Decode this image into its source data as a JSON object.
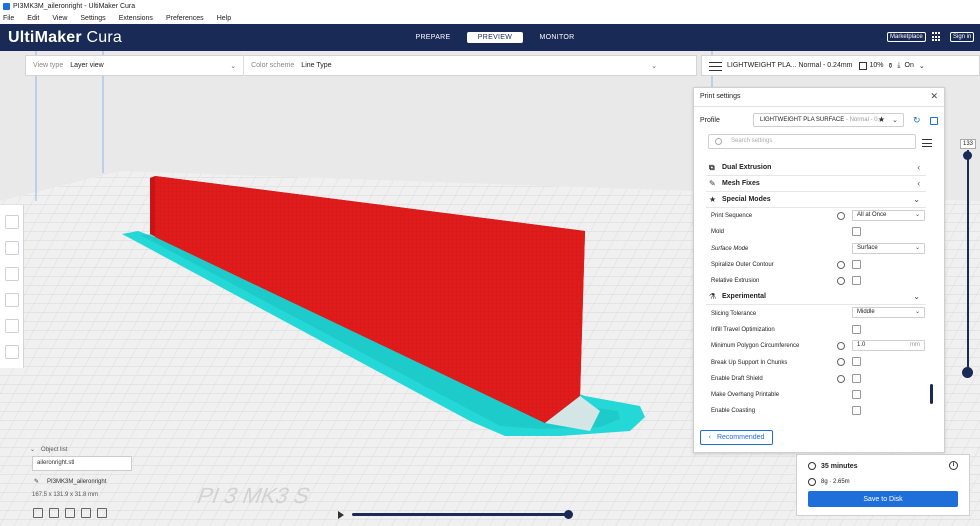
{
  "window": {
    "title": "PI3MK3M_aileronright - UltiMaker Cura"
  },
  "menu": [
    "File",
    "Edit",
    "View",
    "Settings",
    "Extensions",
    "Preferences",
    "Help"
  ],
  "header": {
    "logo_bold": "UltiMaker",
    "logo_light": " Cura",
    "stages": [
      "PREPARE",
      "PREVIEW",
      "MONITOR"
    ],
    "active_stage": "PREVIEW",
    "marketplace": "Marketplace",
    "signin": "Sign in"
  },
  "viewbar": {
    "view_type_label": "View type",
    "view_type_value": "Layer view",
    "color_scheme_label": "Color scheme",
    "color_scheme_value": "Line Type"
  },
  "summary": {
    "profile": "LIGHTWEIGHT PLA... Normal - 0.24mm",
    "infill": "10%",
    "adhesion": "On"
  },
  "print_settings": {
    "title": "Print settings",
    "profile_label": "Profile",
    "profile_name": "LIGHTWEIGHT PLA SURFACE",
    "profile_suffix": " - Normal - 0...",
    "search_placeholder": "Search settings",
    "categories": {
      "dual": "Dual Extrusion",
      "mesh": "Mesh Fixes",
      "special": "Special Modes",
      "experimental": "Experimental"
    },
    "special_settings": [
      {
        "label": "Print Sequence",
        "type": "select",
        "value": "All at Once",
        "linked": true
      },
      {
        "label": "Mold",
        "type": "check"
      },
      {
        "label": "Surface Mode",
        "type": "select",
        "value": "Surface"
      },
      {
        "label": "Spiralize Outer Contour",
        "type": "check",
        "linked": true
      },
      {
        "label": "Relative Extrusion",
        "type": "check",
        "linked": true
      }
    ],
    "experimental_settings": [
      {
        "label": "Slicing Tolerance",
        "type": "select",
        "value": "Middle"
      },
      {
        "label": "Infill Travel Optimization",
        "type": "check"
      },
      {
        "label": "Minimum Polygon Circumference",
        "type": "number",
        "value": "1.0",
        "unit": "mm",
        "linked": true
      },
      {
        "label": "Break Up Support In Chunks",
        "type": "check",
        "linked": true
      },
      {
        "label": "Enable Draft Shield",
        "type": "check",
        "linked": true
      },
      {
        "label": "Make Overhang Printable",
        "type": "check"
      },
      {
        "label": "Enable Coasting",
        "type": "check"
      }
    ],
    "recommended_button": "Recommended"
  },
  "layer_slider": {
    "value": "133"
  },
  "object_list": {
    "label": "Object list",
    "file": "aileronright.stl",
    "object_name": "PI3MK3M_aileronright",
    "dimensions": "167.5 x 131.9 x 31.8 mm"
  },
  "print_summary": {
    "time": "35 minutes",
    "material": "8g · 2.65m",
    "save_button": "Save to Disk"
  },
  "colors": {
    "header_bg": "#192a56",
    "accent": "#1e6fd9",
    "wall": "#e01b1b",
    "brim": "#25d8d8"
  }
}
